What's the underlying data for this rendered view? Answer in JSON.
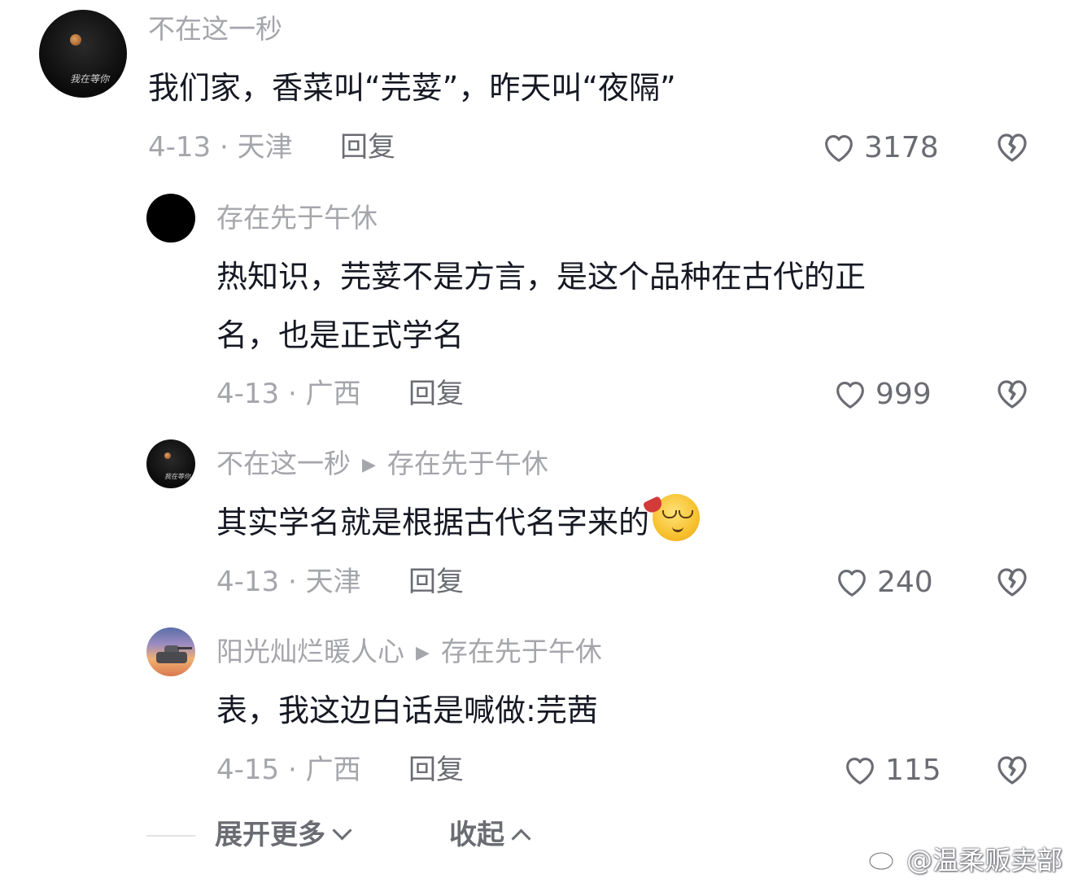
{
  "comments": [
    {
      "username": "不在这一秒",
      "text_lines": [
        "我们家，香菜叫“芫荽”，昨天叫“夜隔”"
      ],
      "date_location": "4-13 · 天津",
      "reply_label": "回复",
      "likes": "3178"
    },
    {
      "username": "存在先于午休",
      "text_lines": [
        "热知识，芫荽不是方言，是这个品种在古代的正",
        "名，也是正式学名"
      ],
      "date_location": "4-13 · 广西",
      "reply_label": "回复",
      "likes": "999"
    },
    {
      "username": "不在这一秒",
      "reply_to": "存在先于午休",
      "text": "其实学名就是根据古代名字来的",
      "emoji": "tipsy-face-emoji",
      "date_location": "4-13 · 天津",
      "reply_label": "回复",
      "likes": "240"
    },
    {
      "username": "阳光灿烂暖人心",
      "reply_to": "存在先于午休",
      "text": "表，我这边白话是喊做:芫茜",
      "date_location": "4-15 · 广西",
      "reply_label": "回复",
      "likes": "115"
    }
  ],
  "footer": {
    "expand_more": "展开更多",
    "collapse": "收起"
  },
  "watermark": "@温柔贩卖部",
  "avatar_scribble": "我在等你"
}
